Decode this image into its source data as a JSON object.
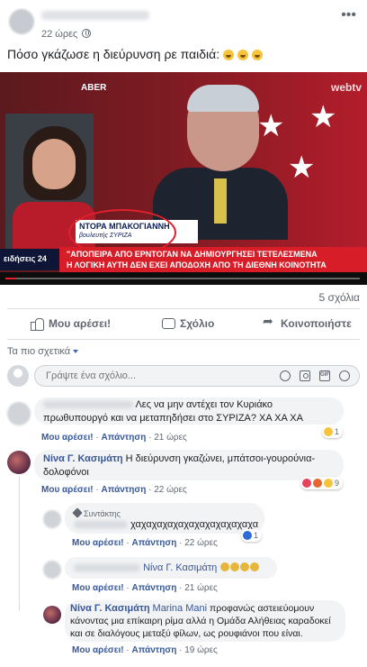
{
  "post": {
    "time": "22 ώρες",
    "text": "Πόσο γκάζωσε η διεύρυνση ρε παιδιά:",
    "emoji_count": 3
  },
  "video": {
    "brand_left": "ABER",
    "brand_right": "webtv",
    "name_title": "ΝΤΟΡΑ ΜΠΑΚΟΓΙΑΝΝΗ",
    "name_subtitle": "βουλευτής ΣΥΡΙΖΑ",
    "ticker_line1": "\"ΑΠΟΠΕΙΡΑ ΑΠΟ   ΕΡΝΤΟΓΑΝ ΝΑ ΔΗΜΙΟΥΡΓΗΣΕΙ ΤΕΤΕΛΕΣΜΕΝΑ",
    "ticker_line2": "Η ΛΟΓΙΚΗ ΑΥΤΗ ΔΕΝ ΕΧΕΙ ΑΠΟΔΟΧΗ ΑΠΟ ΤΗ ΔΙΕΘΝΗ ΚΟΙΝΟΤΗΤΑ",
    "news_logo": "ειδήσεις 24",
    "progress_fraction": 0.03
  },
  "stats": {
    "comment_count": "5 σχόλια"
  },
  "actions": {
    "like": "Μου αρέσει!",
    "comment": "Σχόλιο",
    "share": "Κοινοποιήστε"
  },
  "sort": {
    "label": "Τα πιο σχετικά"
  },
  "composer": {
    "placeholder": "Γράψτε ένα σχόλιο...",
    "gif_label": "GIF"
  },
  "meta_labels": {
    "like": "Μου αρέσει!",
    "reply": "Απάντηση"
  },
  "comments": [
    {
      "text": "Λες να μην αντέχει τον Κυριάκο πρωθυπουργό και να μεταπηδήσει στο ΣΥΡΙΖΑ? ΧΑ ΧΑ ΧΑ",
      "time": "21 ώρες",
      "reaction_count": "1"
    },
    {
      "author": "Νίνα Γ. Κασιμάτη",
      "text": "Η διεύρυνση γκαζώνει, μπάτσοι-γουρούνια-δολοφόνοι",
      "time": "22 ώρες",
      "reaction_count": "9"
    }
  ],
  "replies": [
    {
      "badge": "Συντάκτης",
      "text": "χαχαχαχαχαχαχαχαχαχαχαχα",
      "time": "22 ώρες",
      "reaction_count": "1"
    },
    {
      "mention": "Νίνα Γ. Κασιμάτη",
      "time": "21 ώρες"
    },
    {
      "author": "Νίνα Γ. Κασιμάτη",
      "mention": "Marina Mani",
      "text": "προφανώς αστειεύομουν κάνοντας μια επίκαιρη ρίμα αλλά η Ομάδα Αλήθειας καραδοκεί και σε διαλόγους μεταξύ φίλων, ως ρουφιάνοι που είναι.",
      "time": "19 ώρες"
    }
  ]
}
